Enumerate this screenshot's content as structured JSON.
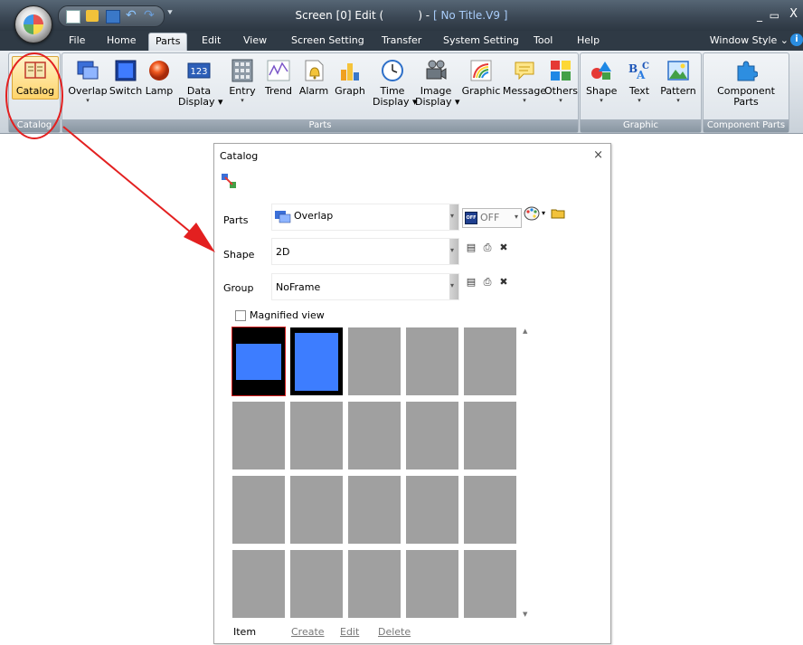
{
  "window": {
    "title_left": "Screen [0] Edit (",
    "title_right": ") - ",
    "title_file": "[ No Title.V9 ]"
  },
  "menu": {
    "tabs": [
      {
        "label": "File"
      },
      {
        "label": "Home"
      },
      {
        "label": "Parts",
        "active": true
      },
      {
        "label": "Edit"
      },
      {
        "label": "View"
      },
      {
        "label": "Screen Setting"
      },
      {
        "label": "Transfer"
      },
      {
        "label": "System Setting"
      },
      {
        "label": "Tool"
      },
      {
        "label": "Help"
      }
    ],
    "window_style": "Window Style"
  },
  "ribbon": {
    "groups": {
      "catalog": "Catalog",
      "parts": "Parts",
      "graphic": "Graphic",
      "component_parts": "Component Parts"
    },
    "buttons": {
      "catalog": "Catalog",
      "overlap": "Overlap",
      "switch": "Switch",
      "lamp": "Lamp",
      "data_display_1": "Data",
      "data_display_2": "Display",
      "entry": "Entry",
      "trend": "Trend",
      "alarm": "Alarm",
      "graph": "Graph",
      "time_display_1": "Time",
      "time_display_2": "Display",
      "image_display_1": "Image",
      "image_display_2": "Display",
      "graphic": "Graphic",
      "message": "Message",
      "others": "Others",
      "shape": "Shape",
      "text": "Text",
      "pattern": "Pattern",
      "component_parts_1": "Component",
      "component_parts_2": "Parts"
    }
  },
  "catalog_panel": {
    "title": "Catalog",
    "parts_label": "Parts",
    "parts_value": "Overlap",
    "off_value": "OFF",
    "off_badge": "OFF",
    "shape_label": "Shape",
    "shape_value": "2D",
    "group_label": "Group",
    "group_value": "NoFrame",
    "magnified_view": "Magnified view",
    "magnified_checked": false,
    "item_label": "Item",
    "links": {
      "create": "Create",
      "edit": "Edit",
      "delete": "Delete"
    }
  },
  "colors": {
    "title_bar": "#3a4653",
    "accent_blue": "#3d7dff",
    "highlight_red": "#e32020"
  }
}
